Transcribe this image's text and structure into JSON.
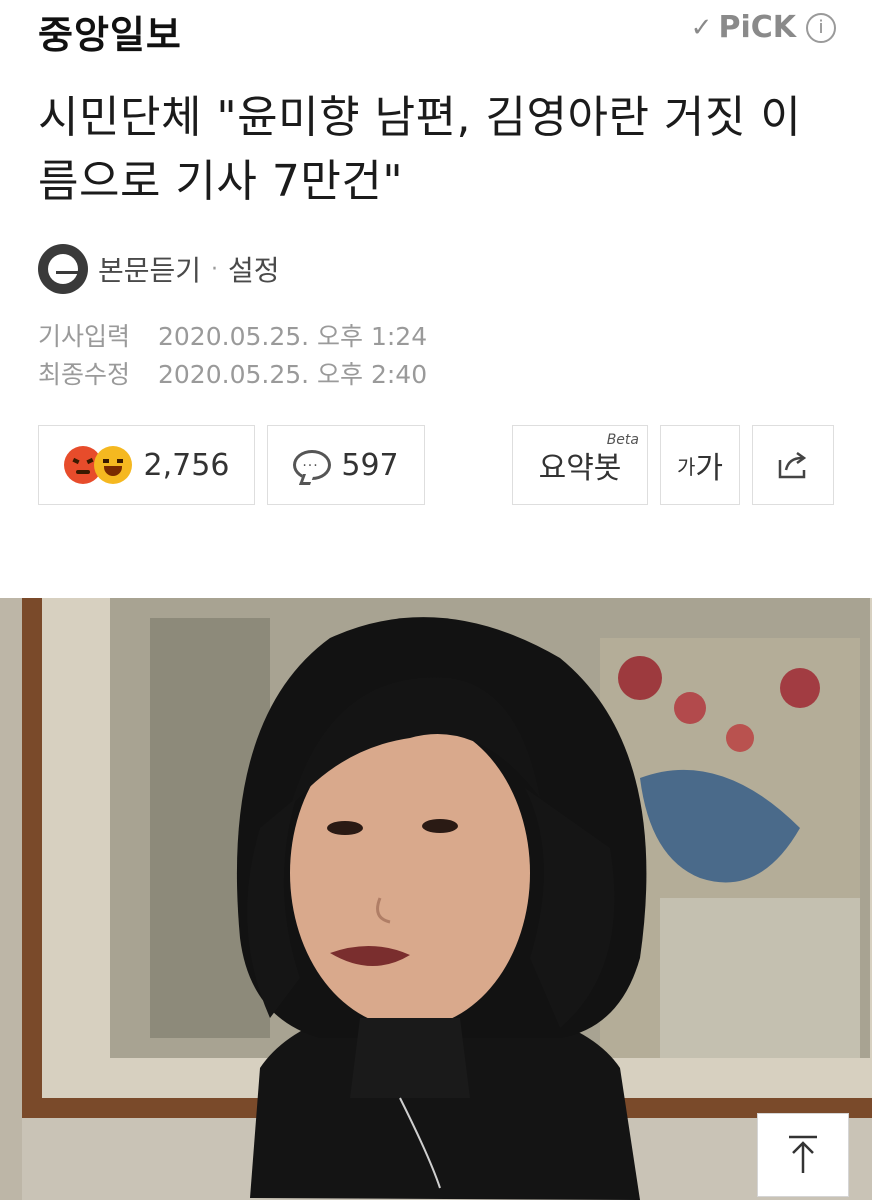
{
  "header": {
    "logo": "중앙일보",
    "pick_label": "PiCK",
    "info_icon": "info-icon"
  },
  "article": {
    "title": "시민단체 \"윤미향 남편, 김영아란 거짓 이름으로 기사 7만건\"",
    "listen_label": "본문듣기",
    "settings_label": "설정",
    "published_label": "기사입력",
    "published_value": "2020.05.25. 오후 1:24",
    "modified_label": "최종수정",
    "modified_value": "2020.05.25. 오후 2:40"
  },
  "actions": {
    "reaction_count": "2,756",
    "comment_count": "597",
    "summary_label": "요약봇",
    "summary_beta": "Beta",
    "font_small": "가",
    "font_large": "가",
    "share_icon": "share-icon"
  },
  "photo": {
    "description_icon": "article-photo"
  },
  "colors": {
    "text": "#1b1b1b",
    "muted": "#9a9a9a",
    "border": "#dedede",
    "angry_emoji": "#e74c2b",
    "laugh_emoji": "#f5b820"
  }
}
